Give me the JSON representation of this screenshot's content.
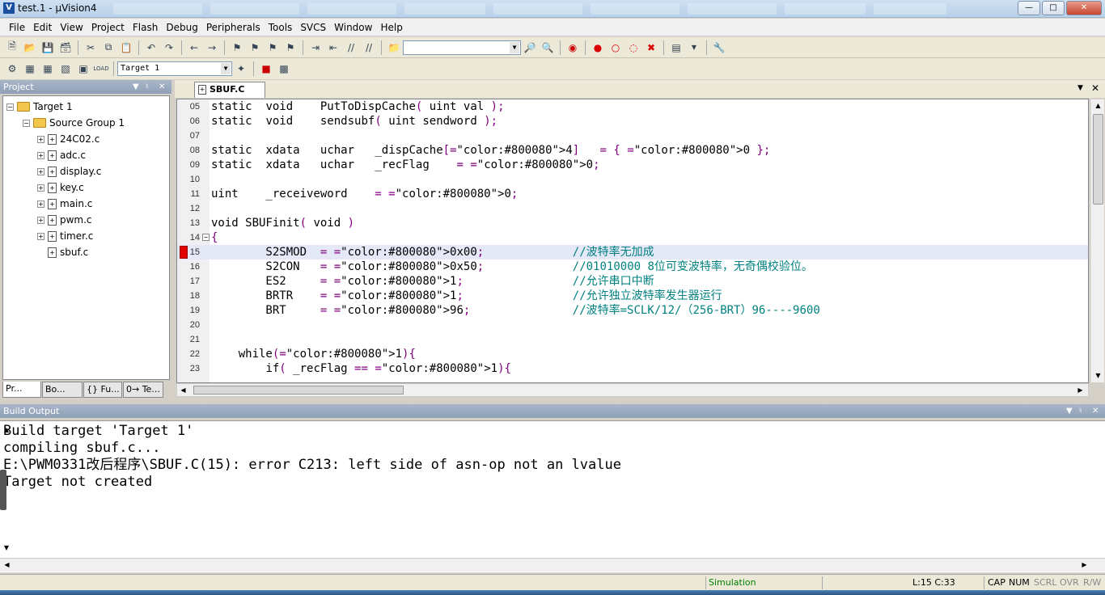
{
  "window": {
    "title": "test.1 - μVision4",
    "app_icon": "keil-uvision-icon",
    "controls": [
      "minimize",
      "maximize",
      "close"
    ]
  },
  "menu": [
    "File",
    "Edit",
    "View",
    "Project",
    "Flash",
    "Debug",
    "Peripherals",
    "Tools",
    "SVCS",
    "Window",
    "Help"
  ],
  "toolbar2": {
    "target_combo": "Target 1"
  },
  "project_panel": {
    "header": "Project",
    "tree": {
      "target": "Target 1",
      "group": "Source Group 1",
      "files": [
        "24C02.c",
        "adc.c",
        "display.c",
        "key.c",
        "main.c",
        "pwm.c",
        "timer.c",
        "sbuf.c"
      ]
    },
    "tabs": [
      "Pr...",
      "Bo...",
      "{} Fu...",
      "0→ Te..."
    ]
  },
  "editor": {
    "tab": "SBUF.C",
    "lines": [
      {
        "num": "05",
        "text": "static  void    PutToDispCache( uint val );"
      },
      {
        "num": "06",
        "text": "static  void    sendsubf( uint sendword );"
      },
      {
        "num": "07",
        "text": ""
      },
      {
        "num": "08",
        "text": "static  xdata   uchar   _dispCache[4]   = { 0 };"
      },
      {
        "num": "09",
        "text": "static  xdata   uchar   _recFlag    = 0;"
      },
      {
        "num": "10",
        "text": ""
      },
      {
        "num": "11",
        "text": "uint    _receiveword    = 0;"
      },
      {
        "num": "12",
        "text": ""
      },
      {
        "num": "13",
        "text": "void SBUFinit( void )"
      },
      {
        "num": "14",
        "text": "{"
      },
      {
        "num": "15",
        "text": "        S2SMOD  = 0x00;             //波特率无加成"
      },
      {
        "num": "16",
        "text": "        S2CON   = 0x50;             //01010000 8位可变波特率，无奇偶校验位。"
      },
      {
        "num": "17",
        "text": "        ES2     = 1;                //允许串口中断"
      },
      {
        "num": "18",
        "text": "        BRTR    = 1;                //允许独立波特率发生器运行"
      },
      {
        "num": "19",
        "text": "        BRT     = 96;               //波特率=SCLK/12/（256-BRT）96----9600"
      },
      {
        "num": "20",
        "text": ""
      },
      {
        "num": "21",
        "text": ""
      },
      {
        "num": "22",
        "text": "    while(1){"
      },
      {
        "num": "23",
        "text": "        if( _recFlag == 1){"
      }
    ]
  },
  "build_output": {
    "header": "Build Output",
    "lines": [
      "Build target 'Target 1'",
      "compiling sbuf.c...",
      "E:\\PWM0331改后程序\\SBUF.C(15): error C213: left side of asn-op not an lvalue",
      "Target not created"
    ]
  },
  "status": {
    "mode": "Simulation",
    "position": "L:15 C:33",
    "cap": "CAP",
    "num": "NUM",
    "scrl": "SCRL",
    "ovr": "OVR",
    "rw": "R/W"
  },
  "colors": {
    "keyword": "#000000",
    "number": "#800080",
    "comment": "#008080",
    "highlight_line": "#e4e8f7",
    "breakpoint": "#e00000",
    "simulation_text": "#008000"
  }
}
